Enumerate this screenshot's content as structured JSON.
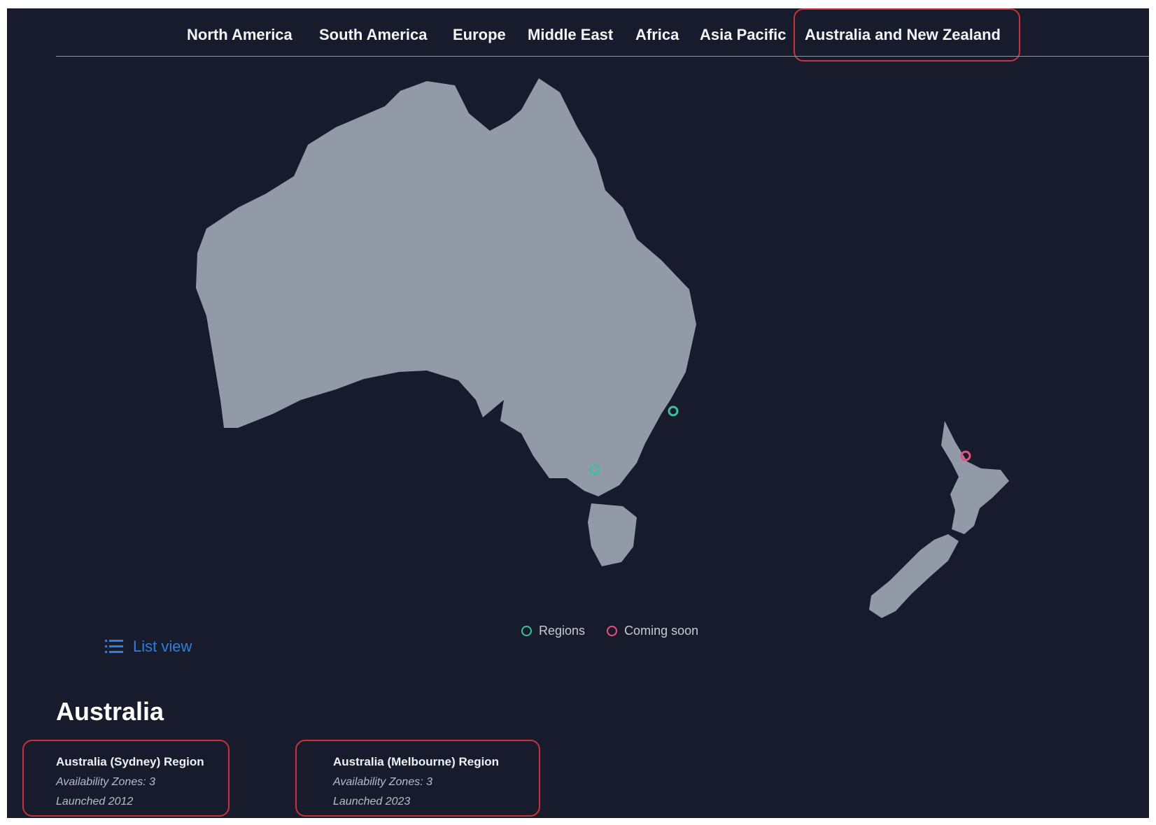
{
  "nav": {
    "tabs": [
      {
        "label": "North America"
      },
      {
        "label": "South America"
      },
      {
        "label": "Europe"
      },
      {
        "label": "Middle East"
      },
      {
        "label": "Africa"
      },
      {
        "label": "Asia Pacific"
      },
      {
        "label": "Australia and New Zealand",
        "selected": true
      }
    ]
  },
  "map": {
    "land_color": "#929aa8",
    "background_color": "#171b2c",
    "markers": [
      {
        "type": "region",
        "near": "Sydney"
      },
      {
        "type": "region",
        "near": "Melbourne"
      },
      {
        "type": "coming_soon",
        "near": "Auckland"
      }
    ]
  },
  "legend": {
    "regions_label": "Regions",
    "regions_color": "#3fbf9f",
    "coming_soon_label": "Coming soon",
    "coming_soon_color": "#e8517f"
  },
  "list_view": {
    "label": "List view",
    "icon": "list-icon"
  },
  "country": {
    "title": "Australia"
  },
  "regions": [
    {
      "name": "Australia (Sydney) Region",
      "zones": "Availability Zones: 3",
      "launched": "Launched 2012"
    },
    {
      "name": "Australia (Melbourne) Region",
      "zones": "Availability Zones: 3",
      "launched": "Launched 2023"
    }
  ],
  "highlight_color": "#c8323c"
}
